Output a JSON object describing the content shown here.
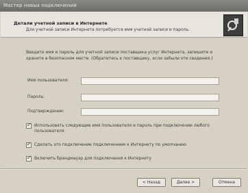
{
  "window": {
    "title": "Мастер новых подключений"
  },
  "header": {
    "title": "Детали учетной записи в Интернете",
    "subtitle": "Для учетной записи Интернета потребуется имя учетной записи и пароль.",
    "icon": "wizard-icon"
  },
  "intro_text": "Введите имя и пароль для учетной записи поставщика услуг Интернета, запишите и храните в безопасном месте. (Обратитесь к поставщику, если забыли эти сведения.)",
  "fields": [
    {
      "label": "Имя пользователя:",
      "value": ""
    },
    {
      "label": "Пароль:",
      "value": ""
    },
    {
      "label": "Подтверждение:",
      "value": ""
    }
  ],
  "checkboxes": [
    {
      "label": "Использовать следующие имя пользователя и пароль при подключении любого пользователя",
      "checked": true
    },
    {
      "label": "Сделать это подключение подключением к Интернету по умолчанию",
      "checked": true
    },
    {
      "label": "Включить брандмауэр для подключения к Интернету",
      "checked": true
    }
  ],
  "buttons": {
    "back": "< Назад",
    "next": "Далее >",
    "cancel": "Отмена"
  },
  "colors": {
    "title_bar": "#7a7874",
    "header_bg": "#e7e5de",
    "body_bg": "#d6d1c2"
  }
}
